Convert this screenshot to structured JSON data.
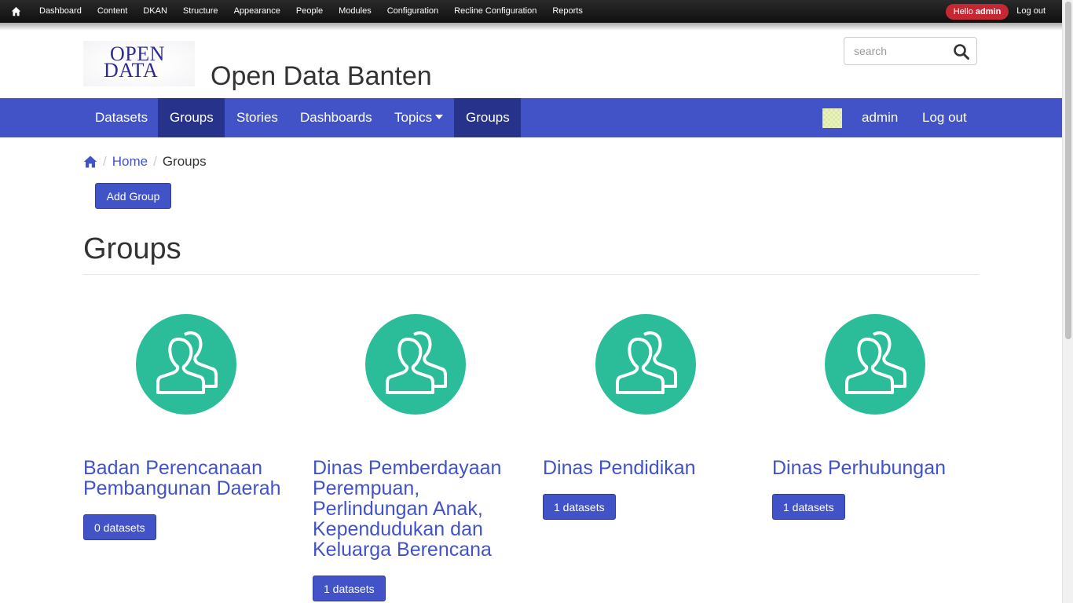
{
  "admin_bar": {
    "menu": [
      "Dashboard",
      "Content",
      "DKAN",
      "Structure",
      "Appearance",
      "People",
      "Modules",
      "Configuration",
      "Recline Configuration",
      "Reports"
    ],
    "hello_prefix": "Hello",
    "hello_user": "admin",
    "logout": "Log out"
  },
  "header": {
    "logo_line1": "OPEN",
    "logo_line2": "DATA",
    "site_title": "Open Data Banten",
    "search_placeholder": "search"
  },
  "nav": {
    "items": [
      "Datasets",
      "Groups",
      "Stories",
      "Dashboards",
      "Topics",
      "Groups"
    ],
    "user": "admin",
    "logout": "Log out"
  },
  "breadcrumb": {
    "home": "Home",
    "current": "Groups"
  },
  "add_group": "Add Group",
  "page_title": "Groups",
  "groups": [
    {
      "name": "Badan Perencanaan Pembangunan Daerah",
      "count": "0 datasets"
    },
    {
      "name": "Dinas Pemberdayaan Perempuan, Perlindungan Anak, Kependudukan dan Keluarga Berencana",
      "count": "1 datasets"
    },
    {
      "name": "Dinas Pendidikan",
      "count": "1 datasets"
    },
    {
      "name": "Dinas Perhubungan",
      "count": "1 datasets"
    }
  ],
  "colors": {
    "nav": "#4153c7",
    "nav_active": "#27328a",
    "group_circle": "#2bbc99",
    "hello_badge": "#c62833"
  }
}
